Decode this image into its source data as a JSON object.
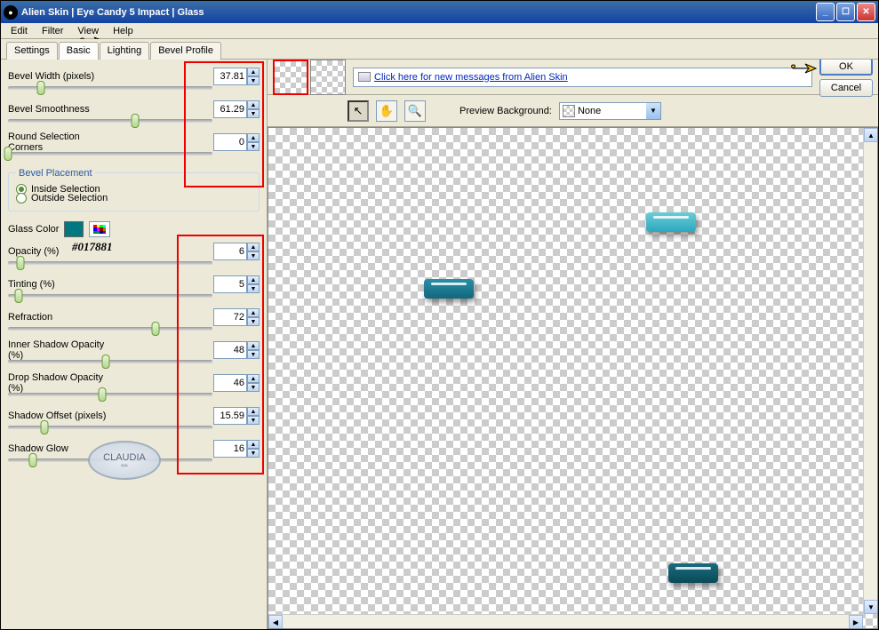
{
  "title": "Alien Skin  |  Eye Candy 5 Impact  |  Glass",
  "menu": [
    "Edit",
    "Filter",
    "View",
    "Help"
  ],
  "tabs": [
    "Settings",
    "Basic",
    "Lighting",
    "Bevel Profile"
  ],
  "active_tab": "Basic",
  "params": {
    "bevel_width": {
      "label": "Bevel Width (pixels)",
      "value": "37.81",
      "thumb_pct": 16
    },
    "bevel_smoothness": {
      "label": "Bevel Smoothness",
      "value": "61.29",
      "thumb_pct": 62
    },
    "round_corners": {
      "label": "Round Selection Corners",
      "value": "0",
      "thumb_pct": 0
    },
    "opacity": {
      "label": "Opacity (%)",
      "value": "6",
      "thumb_pct": 6
    },
    "tinting": {
      "label": "Tinting (%)",
      "value": "5",
      "thumb_pct": 5
    },
    "refraction": {
      "label": "Refraction",
      "value": "72",
      "thumb_pct": 72
    },
    "inner_shadow": {
      "label": "Inner Shadow Opacity (%)",
      "value": "48",
      "thumb_pct": 48
    },
    "drop_shadow": {
      "label": "Drop Shadow Opacity (%)",
      "value": "46",
      "thumb_pct": 46
    },
    "shadow_offset": {
      "label": "Shadow Offset (pixels)",
      "value": "15.59",
      "thumb_pct": 18
    },
    "shadow_glow": {
      "label": "Shadow Glow",
      "value": "16",
      "thumb_pct": 12
    }
  },
  "bevel_placement": {
    "legend": "Bevel Placement",
    "inside": "Inside Selection",
    "outside": "Outside Selection",
    "selected": "inside"
  },
  "glass_color": {
    "label": "Glass Color",
    "hex": "#017881"
  },
  "message": "Click here for new messages from Alien Skin",
  "preview_bg": {
    "label": "Preview Background:",
    "value": "None"
  },
  "buttons": {
    "ok": "OK",
    "cancel": "Cancel"
  },
  "watermark": "CLAUDIA"
}
